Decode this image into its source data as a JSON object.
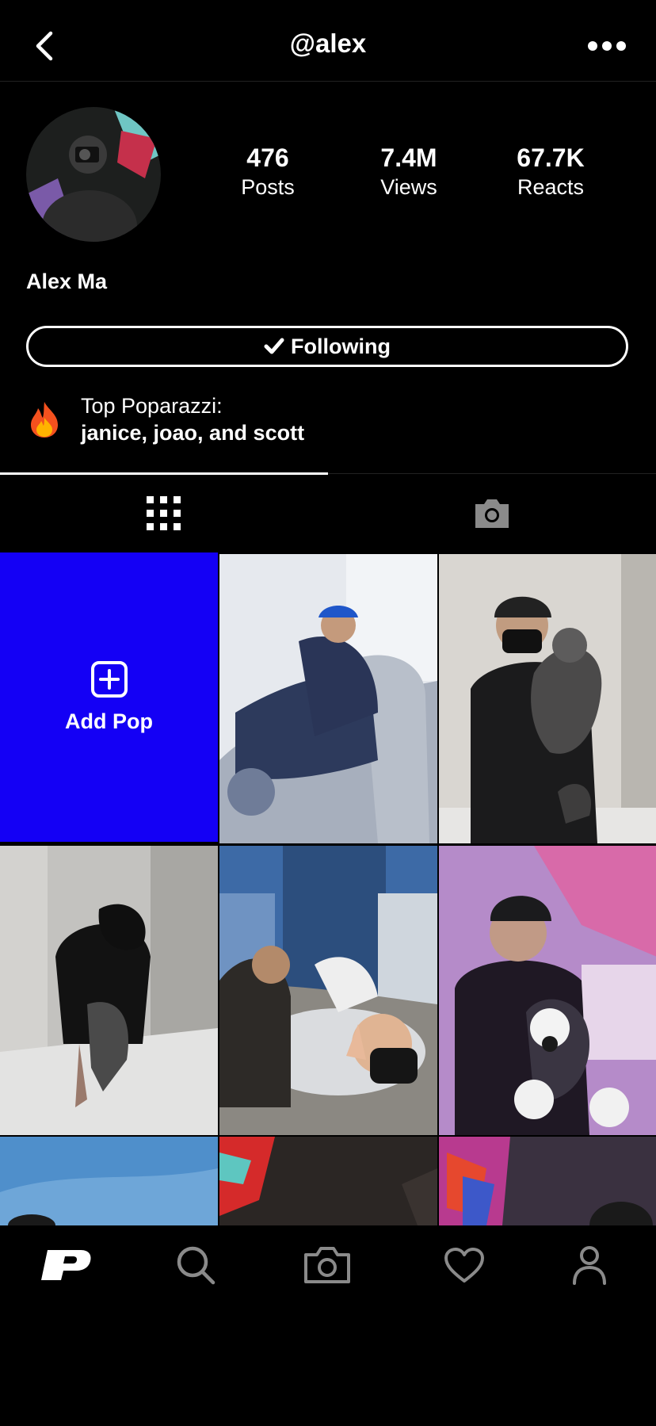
{
  "header": {
    "title": "@alex"
  },
  "profile": {
    "name": "Alex Ma",
    "stats": [
      {
        "value": "476",
        "label": "Posts"
      },
      {
        "value": "7.4M",
        "label": "Views"
      },
      {
        "value": "67.7K",
        "label": "Reacts"
      }
    ],
    "follow_label": "Following",
    "top_poparazzi_label": "Top Poparazzi:",
    "top_poparazzi_names": "janice, joao, and scott"
  },
  "tabs": [
    {
      "icon": "grid-icon",
      "active": true
    },
    {
      "icon": "camera-icon",
      "active": false
    }
  ],
  "grid": {
    "add_label": "Add Pop",
    "accent": "#1400f5"
  },
  "nav": [
    "logo-icon",
    "search-icon",
    "camera-icon",
    "heart-icon",
    "profile-icon"
  ]
}
